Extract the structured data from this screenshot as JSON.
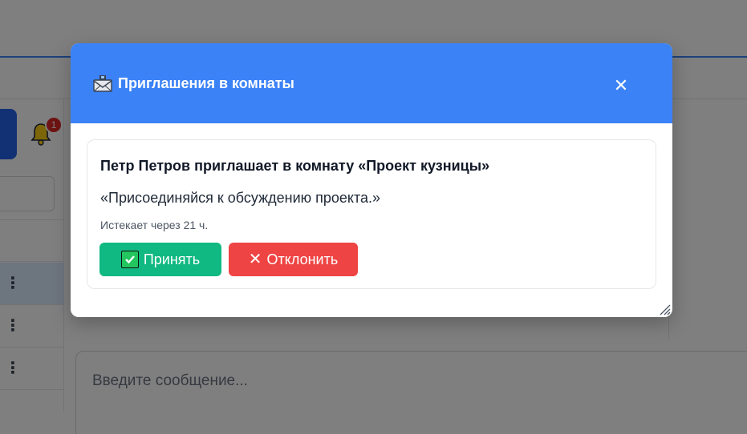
{
  "background": {
    "notification_count": "1",
    "message_placeholder": "Введите сообщение..."
  },
  "modal": {
    "title": "Приглашения в комнаты",
    "close_label": "✕",
    "invitation": {
      "title": "Петр Петров приглашает в комнату «Проект кузницы»",
      "message": "«Присоединяйся к обсуждению проекта.»",
      "expires": "Истекает через 21 ч.",
      "accept_label": "Принять",
      "decline_label": "Отклонить"
    }
  },
  "colors": {
    "header": "#3b82f6",
    "accept": "#10b981",
    "decline": "#ef4444",
    "badge": "#dc2626"
  }
}
